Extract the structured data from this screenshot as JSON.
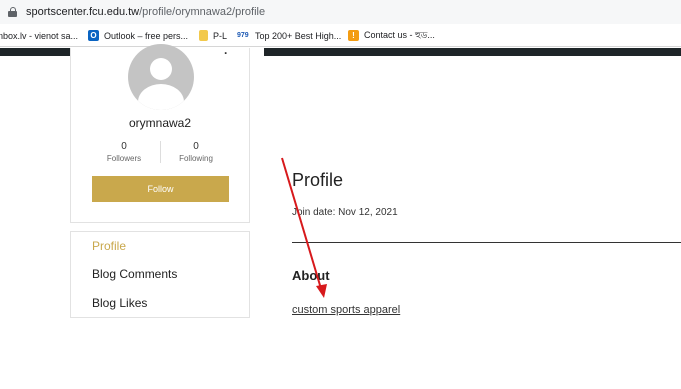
{
  "browser": {
    "url_host": "sportscenter.fcu.edu.tw",
    "url_path": "/profile/orymnawa2/profile",
    "bookmarks": [
      {
        "label": "nbox.lv - vienot sa..."
      },
      {
        "label": "Outlook – free pers..."
      },
      {
        "label": "P-L"
      },
      {
        "label": "Top 200+ Best High..."
      },
      {
        "label": "Contact us - হুড..."
      }
    ]
  },
  "profile": {
    "username": "orymnawa2",
    "followers_count": "0",
    "followers_label": "Followers",
    "following_count": "0",
    "following_label": "Following",
    "follow_button": "Follow",
    "menu_dots": "·"
  },
  "menu": {
    "items": [
      {
        "label": "Profile"
      },
      {
        "label": "Blog Comments"
      },
      {
        "label": "Blog Likes"
      }
    ]
  },
  "main": {
    "title": "Profile",
    "join_date": "Join date: Nov 12, 2021",
    "about_heading": "About",
    "about_link": "custom sports apparel"
  },
  "colors": {
    "accent": "#c9a84c",
    "header_dark": "#1e2528",
    "annotation_arrow": "#d7191c"
  }
}
